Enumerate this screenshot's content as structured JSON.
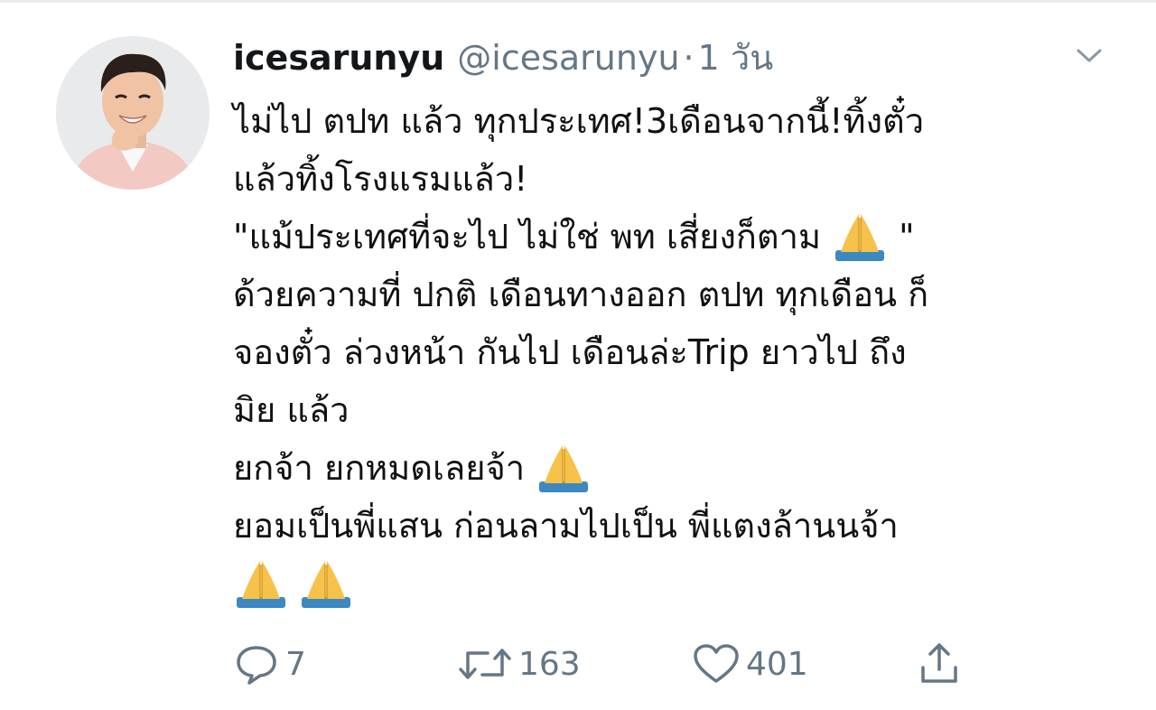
{
  "tweet": {
    "display_name": "icesarunyu",
    "handle": "@icesarunyu",
    "separator": "·",
    "time": "1 วัน",
    "lines": [
      "ไม่ไป ตปท แล้ว ทุกประเทศ!3เดือนจากนี้!ทิ้งตั๋ว",
      "แล้วทิ้งโรงแรมแล้ว!",
      "\"แม้ประเทศที่จะไป ไม่ใช่ พท เสี่ยงก็ตาม ",
      " \"",
      "ด้วยความที่ ปกติ เดือนทางออก ตปท ทุกเดือน ก็",
      "จองตั๋ว ล่วงหน้า กันไป เดือนล่ะTrip ยาวไป ถึง",
      "มิย แล้ว",
      "ยกจ้า ยกหมดเลยจ้า ",
      "ยอมเป็นพี่แสน ก่อนลามไปเป็น พี่แตงล้านนจ้า"
    ],
    "emoji_name": "folded-hands-emoji"
  },
  "actions": {
    "reply_count": "7",
    "retweet_count": "163",
    "like_count": "401"
  },
  "icons": {
    "reply": "reply-icon",
    "retweet": "retweet-icon",
    "like": "heart-icon",
    "share": "share-icon",
    "caret": "chevron-down-icon"
  },
  "colors": {
    "text": "#111111",
    "muted": "#657786"
  }
}
